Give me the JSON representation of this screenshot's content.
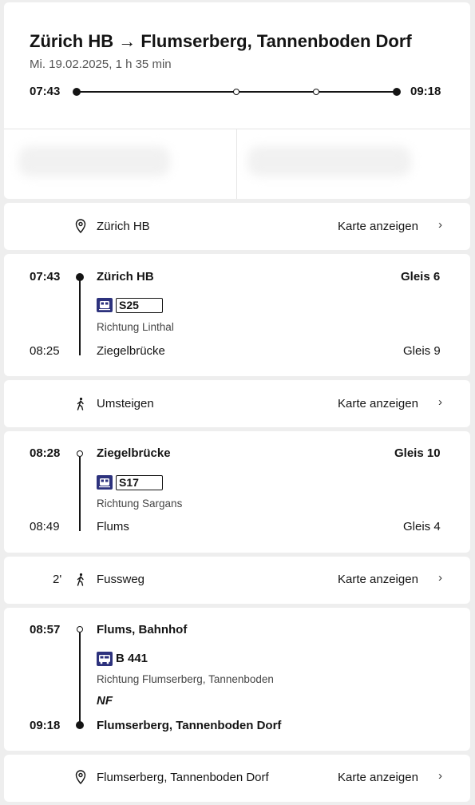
{
  "header": {
    "title": "Zürich HB → Flumserberg, Tannenboden Dorf",
    "subtitle": "Mi. 19.02.2025, 1 h 35 min",
    "dep_time": "07:43",
    "arr_time": "09:18"
  },
  "start_location": {
    "name": "Zürich HB",
    "map_link": "Karte anzeigen",
    "icon": "location-pin-icon"
  },
  "legs": [
    {
      "dep_time": "07:43",
      "dep_stop": "Zürich HB",
      "dep_platform": "Gleis 6",
      "line": "S25",
      "line_icon": "train-icon",
      "direction": "Richtung Linthal",
      "arr_time": "08:25",
      "arr_stop": "Ziegelbrücke",
      "arr_platform": "Gleis 9"
    },
    {
      "dep_time": "08:28",
      "dep_stop": "Ziegelbrücke",
      "dep_platform": "Gleis 10",
      "line": "S17",
      "line_icon": "train-icon",
      "direction": "Richtung Sargans",
      "arr_time": "08:49",
      "arr_stop": "Flums",
      "arr_platform": "Gleis 4"
    },
    {
      "dep_time": "08:57",
      "dep_stop": "Flums, Bahnhof",
      "line": "B 441",
      "line_icon": "bus-icon",
      "direction": "Richtung Flumserberg, Tannenboden",
      "note": "NF",
      "arr_time": "09:18",
      "arr_stop": "Flumserberg, Tannenboden Dorf"
    }
  ],
  "transfer": {
    "label": "Umsteigen",
    "map_link": "Karte anzeigen",
    "icon": "walking-icon"
  },
  "walk": {
    "duration": "2'",
    "label": "Fussweg",
    "map_link": "Karte anzeigen",
    "icon": "walking-icon"
  },
  "end_location": {
    "name": "Flumserberg, Tannenboden Dorf",
    "map_link": "Karte anzeigen",
    "icon": "location-pin-icon"
  },
  "chevron": "›",
  "colors": {
    "transport_badge": "#2d327d",
    "text": "#141414",
    "background": "#eeeeee"
  }
}
